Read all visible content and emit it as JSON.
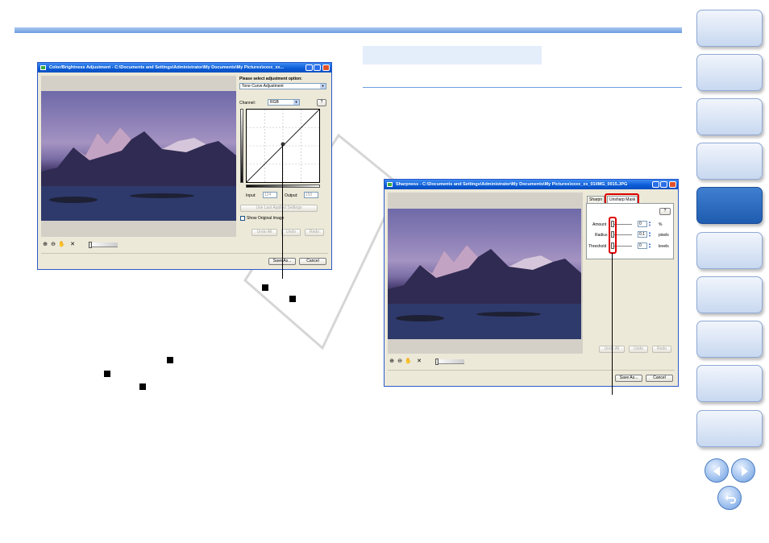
{
  "nav": {
    "tabs": [
      {
        "active": false
      },
      {
        "active": false
      },
      {
        "active": false
      },
      {
        "active": false
      },
      {
        "active": true
      },
      {
        "active": false
      },
      {
        "active": false
      },
      {
        "active": false
      },
      {
        "active": false
      },
      {
        "active": false
      }
    ],
    "prev_icon": "left-arrow-icon",
    "next_icon": "right-arrow-icon",
    "return_icon": "return-icon"
  },
  "color_window": {
    "title": "Color/Brightness Adjustment - C:\\Documents and Settings\\Administrator\\My Documents\\My Pictures\\xxxx_xx...",
    "option_label": "Please select adjustment option:",
    "option_value": "Tone Curve Adjustment",
    "channel_label": "Channel:",
    "channel_value": "RGB",
    "help_label": "?",
    "input_label": "Input:",
    "input_value": "124",
    "output_label": "Output:",
    "output_value": "150",
    "use_last_label": "Use Last Applied Settings",
    "show_original_label": "Show Original Image",
    "undo_all_label": "Undo All",
    "undo_label": "Undo",
    "redo_label": "Redo",
    "save_as_label": "Save As...",
    "cancel_label": "Cancel"
  },
  "sharp_window": {
    "title": "Sharpness - C:\\Documents and Settings\\Administrator\\My Documents\\My Pictures\\xxxx_xx_01\\IMG_0015.JPG",
    "tab_sharpness": "Sharpn",
    "tab_unsharp": "Unsharp Mask",
    "help_label": "?",
    "amount_label": "Amount",
    "amount_value": "0",
    "amount_unit": "%",
    "radius_label": "Radius",
    "radius_value": "0.1",
    "radius_unit": "pixels",
    "threshold_label": "Threshold",
    "threshold_value": "0",
    "threshold_unit": "levels",
    "undo_all_label": "Undo All",
    "undo_label": "Undo",
    "redo_label": "Redo",
    "save_as_label": "Save As...",
    "cancel_label": "Cancel"
  },
  "colors": {
    "accent_blue": "#6e9de0",
    "nav_active": "#2a66bd",
    "highlight_red": "#e00000"
  }
}
